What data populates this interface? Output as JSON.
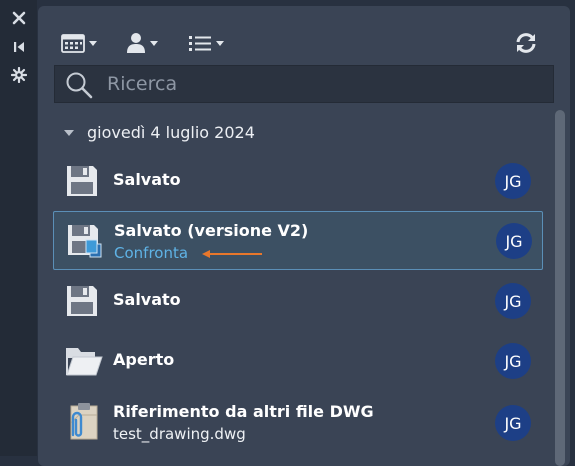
{
  "toolbar": {
    "icons": [
      "calendar-icon",
      "user-icon",
      "list-icon",
      "refresh-icon"
    ]
  },
  "search": {
    "placeholder": "Ricerca"
  },
  "date_group": {
    "label": "giovedì 4 luglio 2024"
  },
  "entries": [
    {
      "title": "Salvato",
      "icon": "floppy-disk-icon",
      "avatar": "JG"
    },
    {
      "title": "Salvato (versione V2)",
      "icon": "floppy-disk-compare-icon",
      "link": "Confronta",
      "avatar": "JG",
      "selected": true
    },
    {
      "title": "Salvato",
      "icon": "floppy-disk-icon",
      "avatar": "JG"
    },
    {
      "title": "Aperto",
      "icon": "open-folder-icon",
      "avatar": "JG"
    },
    {
      "title": "Riferimento da altri file DWG",
      "icon": "clipboard-attachment-icon",
      "subtitle": "test_drawing.dwg",
      "avatar": "JG"
    }
  ],
  "colors": {
    "panel_bg": "#3a4455",
    "selected_bg": "#3c5063",
    "selected_border": "#5b8fb7",
    "link": "#5fb3e6",
    "avatar_bg": "#1d3f86",
    "arrow": "#e8772b"
  }
}
